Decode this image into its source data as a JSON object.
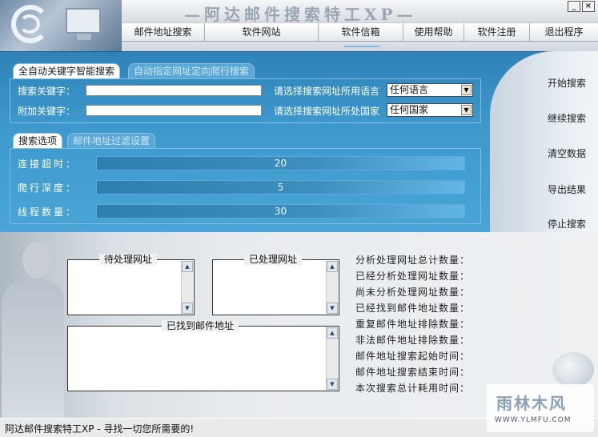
{
  "window": {
    "title": "—阿达邮件搜索特工XP—",
    "minimize": "_",
    "close": "×"
  },
  "menu": [
    {
      "label": "邮件地址搜索",
      "w": 104
    },
    {
      "label": "软件网站",
      "w": 142
    },
    {
      "label": "软件信箱",
      "w": 106
    },
    {
      "label": "使用帮助",
      "w": 76
    },
    {
      "label": "软件注册",
      "w": 82
    },
    {
      "label": "退出程序",
      "w": 85
    }
  ],
  "search_tabs": {
    "active": "全自动关键字智能搜索",
    "inactive": "自动指定网址定向爬行搜索"
  },
  "search": {
    "keyword_label": "搜索关键字：",
    "extra_label": "附加关键字：",
    "keyword_value": "",
    "extra_value": "",
    "language_label": "请选择搜索网址所用语言",
    "language_value": "任何语言",
    "country_label": "请选择搜索网址所处国家",
    "country_value": "任何国家"
  },
  "option_tabs": {
    "active": "搜索选项",
    "inactive": "邮件地址过滤设置"
  },
  "options": {
    "timeout_label": "连接超时：",
    "timeout_value": "20",
    "depth_label": "爬行深度：",
    "depth_value": "5",
    "threads_label": "线程数量：",
    "threads_value": "30"
  },
  "side_buttons": {
    "start": "开始搜索",
    "continue": "继续搜索",
    "clear": "清空数据",
    "export": "导出结果",
    "stop": "停止搜索"
  },
  "lists": {
    "pending": "待处理网址",
    "processed": "已处理网址",
    "found": "已找到邮件地址"
  },
  "stats": [
    "分析处理网址总计数量：",
    "已经分析处理网址数量：",
    "尚未分析处理网址数量：",
    "已经找到邮件地址数量：",
    "重复邮件地址排除数量：",
    "非法邮件地址排除数量：",
    "邮件地址搜索起始时间：",
    "邮件地址搜索结束时间：",
    "本次搜索总计耗用时间："
  ],
  "status_text": "阿达邮件搜索特工XP - 寻找一切您所需要的!",
  "watermark": {
    "title": "雨林木风",
    "url": "WWW.YLMFU.COM"
  }
}
